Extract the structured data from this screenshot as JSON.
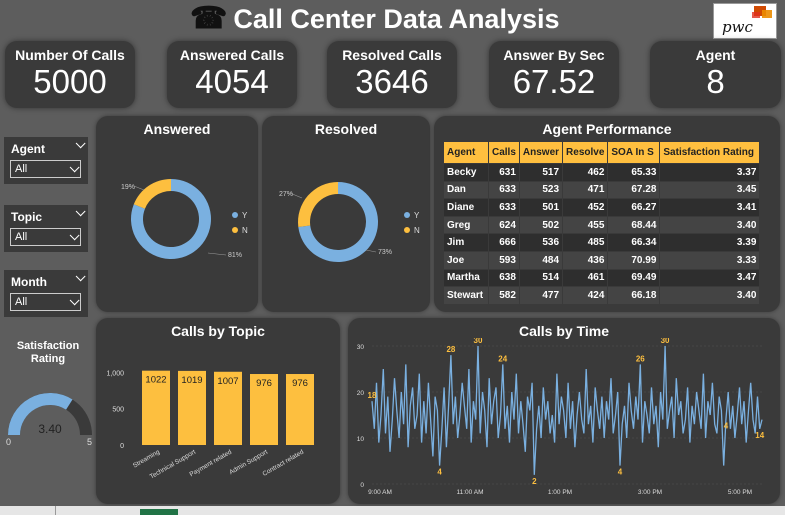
{
  "header": {
    "title": "Call Center Data Analysis",
    "phone_icon": "☎",
    "logo_text": "pwc"
  },
  "kpis": [
    {
      "label": "Number Of Calls",
      "value": "5000"
    },
    {
      "label": "Answered Calls",
      "value": "4054"
    },
    {
      "label": "Resolved Calls",
      "value": "3646"
    },
    {
      "label": "Answer By Sec",
      "value": "67.52"
    },
    {
      "label": "Agent",
      "value": "8"
    }
  ],
  "slicers": [
    {
      "label": "Agent",
      "value": "All"
    },
    {
      "label": "Topic",
      "value": "All"
    },
    {
      "label": "Month",
      "value": "All"
    }
  ],
  "colors": {
    "blue": "#7ab0e0",
    "gold": "#fdbf3f",
    "card": "#3a3a3a",
    "background": "#5d5d5d"
  },
  "answered_title": "Answered",
  "resolved_title": "Resolved",
  "performance": {
    "title": "Agent Performance",
    "columns": [
      "Agent",
      "Calls",
      "Answer",
      "Resolve",
      "SOA In S",
      "Satisfaction Rating"
    ],
    "rows": [
      [
        "Becky",
        "631",
        "517",
        "462",
        "65.33",
        "3.37"
      ],
      [
        "Dan",
        "633",
        "523",
        "471",
        "67.28",
        "3.45"
      ],
      [
        "Diane",
        "633",
        "501",
        "452",
        "66.27",
        "3.41"
      ],
      [
        "Greg",
        "624",
        "502",
        "455",
        "68.44",
        "3.40"
      ],
      [
        "Jim",
        "666",
        "536",
        "485",
        "66.34",
        "3.39"
      ],
      [
        "Joe",
        "593",
        "484",
        "436",
        "70.99",
        "3.33"
      ],
      [
        "Martha",
        "638",
        "514",
        "461",
        "69.49",
        "3.47"
      ],
      [
        "Stewart",
        "582",
        "477",
        "424",
        "66.18",
        "3.40"
      ]
    ]
  },
  "satisfaction": {
    "title": "Satisfaction Rating",
    "value": 3.4,
    "value_label": "3.40",
    "min_label": "0",
    "max_label": "5",
    "min": 0,
    "max": 5
  },
  "chart_data": [
    {
      "type": "pie",
      "title": "Answered",
      "categories": [
        "Y",
        "N"
      ],
      "values": [
        81,
        19
      ],
      "labels": [
        "81%",
        "19%"
      ],
      "legend_position": "right"
    },
    {
      "type": "pie",
      "title": "Resolved",
      "categories": [
        "Y",
        "N"
      ],
      "values": [
        73,
        27
      ],
      "labels": [
        "73%",
        "27%"
      ],
      "legend_position": "right"
    },
    {
      "type": "bar",
      "title": "Calls by Topic",
      "categories": [
        "Streaming",
        "Technical Support",
        "Payment related",
        "Admin Support",
        "Contract related"
      ],
      "values": [
        1022,
        1019,
        1007,
        976,
        976
      ],
      "ylim": [
        0,
        1100
      ],
      "yticks": [
        0,
        500,
        1000
      ],
      "ytick_labels": [
        "0",
        "500",
        "1,000"
      ]
    },
    {
      "type": "line",
      "title": "Calls by Time",
      "x_start": "9:00 AM",
      "x_end": "6:00 PM",
      "xticks": [
        "9:00 AM",
        "11:00 AM",
        "1:00 PM",
        "3:00 PM",
        "5:00 PM"
      ],
      "ylim": [
        0,
        30
      ],
      "yticks": [
        0,
        10,
        20,
        30
      ],
      "values": [
        18,
        12,
        22,
        9,
        15,
        25,
        11,
        19,
        7,
        14,
        23,
        16,
        10,
        20,
        13,
        26,
        8,
        17,
        21,
        12,
        15,
        24,
        9,
        18,
        11,
        22,
        14,
        6,
        19,
        16,
        4,
        12,
        21,
        8,
        17,
        28,
        13,
        19,
        10,
        15,
        22,
        17,
        12,
        25,
        9,
        18,
        14,
        30,
        11,
        20,
        16,
        8,
        23,
        13,
        18,
        21,
        10,
        15,
        26,
        12,
        17,
        9,
        20,
        14,
        24,
        11,
        18,
        13,
        7,
        19,
        16,
        22,
        2,
        12,
        17,
        10,
        21,
        14,
        18,
        11,
        15,
        9,
        24,
        13,
        19,
        16,
        10,
        22,
        12,
        18,
        8,
        15,
        20,
        14,
        11,
        25,
        13,
        17,
        9,
        21,
        16,
        12,
        19,
        10,
        18,
        14,
        23,
        11,
        15,
        20,
        4,
        13,
        17,
        10,
        22,
        16,
        12,
        19,
        14,
        26,
        9,
        18,
        15,
        11,
        21,
        13,
        17,
        8,
        20,
        14,
        30,
        12,
        16,
        19,
        10,
        23,
        15,
        18,
        11,
        14,
        21,
        9,
        17,
        13,
        20,
        16,
        12,
        24,
        10,
        18,
        15,
        22,
        13,
        11,
        19,
        16,
        4,
        14,
        20,
        12,
        17,
        10,
        15,
        21,
        13,
        18,
        9,
        16,
        22,
        14,
        11,
        19,
        12,
        14
      ]
    }
  ],
  "line_labels": [
    {
      "index": 0,
      "text": "18"
    },
    {
      "index": 35,
      "text": "28"
    },
    {
      "index": 47,
      "text": "30"
    },
    {
      "index": 30,
      "text": "4"
    },
    {
      "index": 72,
      "text": "2"
    },
    {
      "index": 58,
      "text": "24"
    },
    {
      "index": 110,
      "text": "4"
    },
    {
      "index": 119,
      "text": "26"
    },
    {
      "index": 130,
      "text": "30"
    },
    {
      "index": 157,
      "text": "4"
    },
    {
      "index": 172,
      "text": "14"
    }
  ]
}
